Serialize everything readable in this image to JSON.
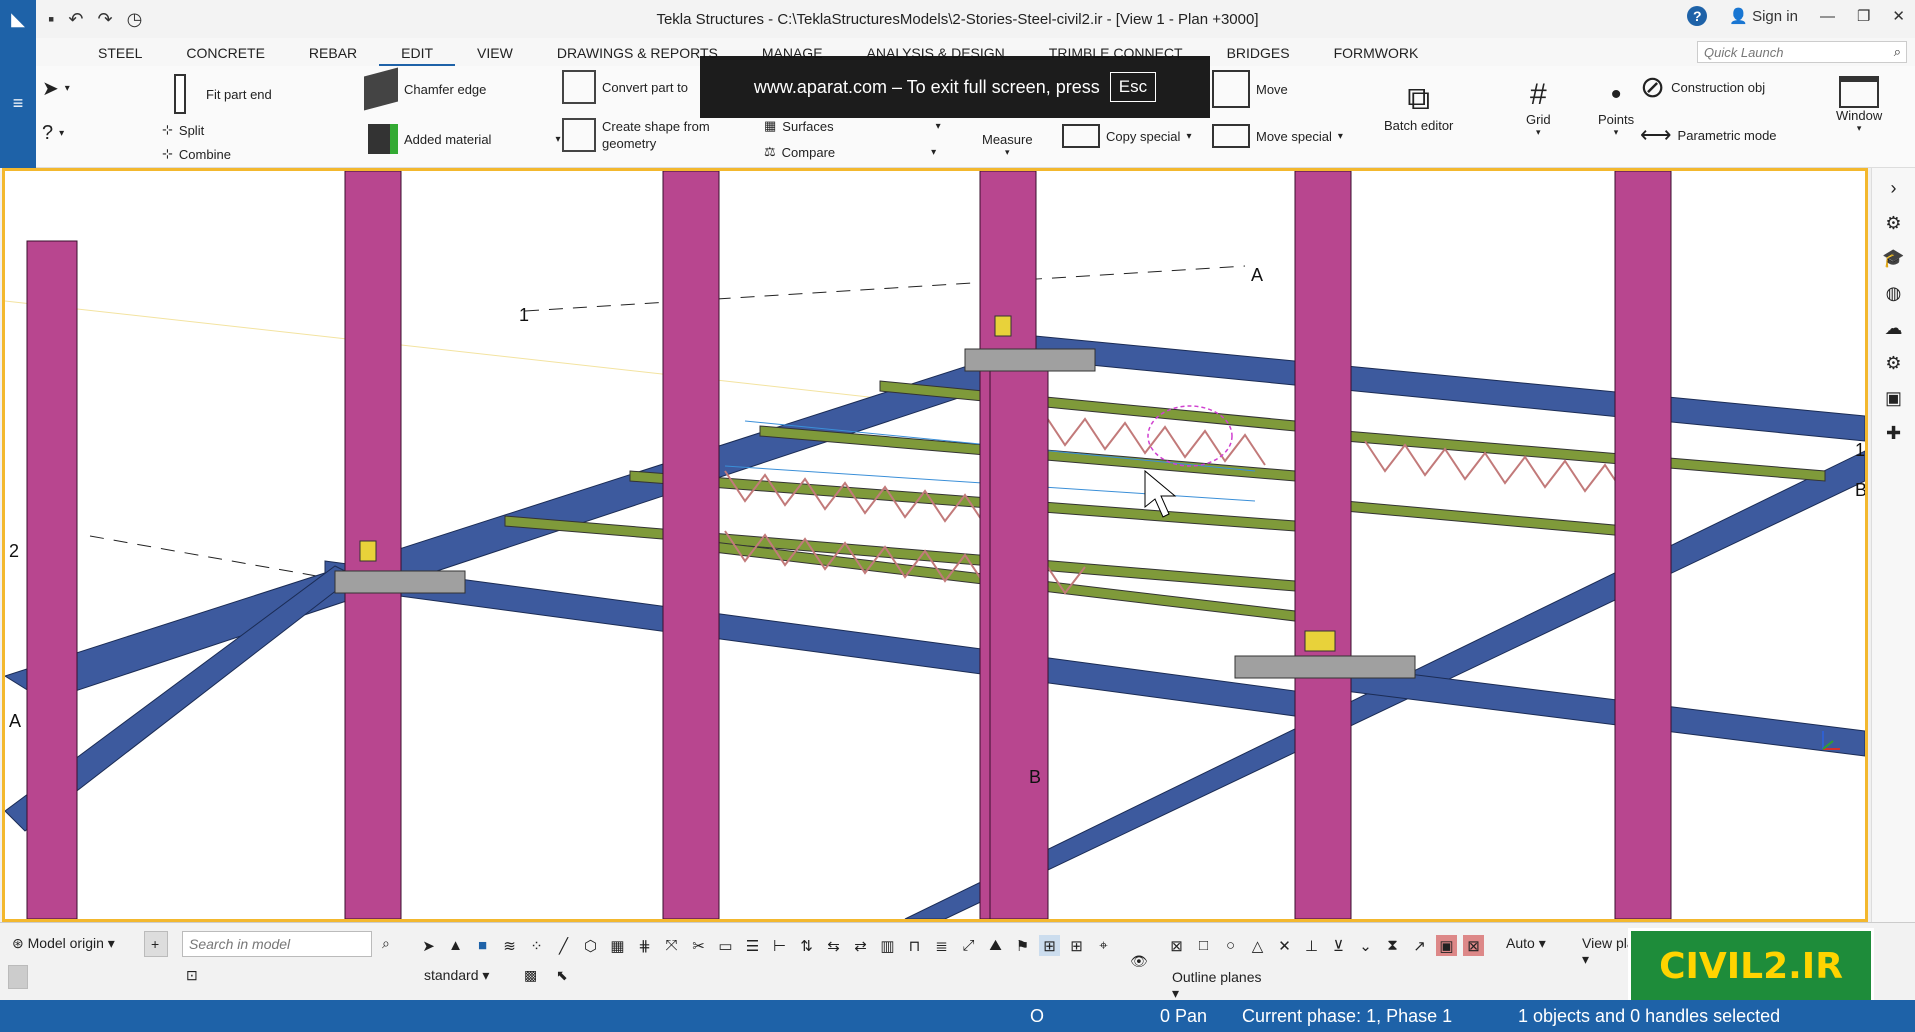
{
  "window": {
    "title": "Tekla Structures - C:\\TeklaStructuresModels\\2-Stories-Steel-civil2.ir  - [View 1 - Plan +3000]",
    "sign_in": "Sign in"
  },
  "tabs": [
    "STEEL",
    "CONCRETE",
    "REBAR",
    "EDIT",
    "VIEW",
    "DRAWINGS & REPORTS",
    "MANAGE",
    "ANALYSIS & DESIGN",
    "TRIMBLE CONNECT",
    "BRIDGES",
    "FORMWORK"
  ],
  "active_tab": "EDIT",
  "quick_launch": {
    "placeholder": "Quick Launch"
  },
  "ribbon": {
    "fit_part_end": "Fit part end",
    "split": "Split",
    "combine": "Combine",
    "chamfer_edge": "Chamfer edge",
    "added_material": "Added material",
    "convert_part": "Convert part to",
    "create_shape": "Create shape from",
    "create_shape_2": "geometry",
    "surfaces": "Surfaces",
    "compare": "Compare",
    "measure": "Measure",
    "copy_special": "Copy special",
    "move": "Move",
    "move_special": "Move special",
    "batch_editor": "Batch editor",
    "grid": "Grid",
    "points": "Points",
    "construction_obj": "Construction obj",
    "parametric_mode": "Parametric mode",
    "window": "Window"
  },
  "fullscreen_notice": {
    "text": "www.aparat.com – To exit full screen, press",
    "key": "Esc"
  },
  "viewport": {
    "grid_labels": {
      "label_a_top": "A",
      "label_1": "1",
      "label_2": "2",
      "label_a_left": "A",
      "label_b_bottom": "B",
      "label_b_right": "B",
      "label_1_right": "1"
    },
    "colors": {
      "column": "#b8468f",
      "beam": "#3d5a9e",
      "joist_chord": "#7f9a3a",
      "joist_web": "#c27a7a",
      "plate": "#e8d23a",
      "frame": "#f3b82e"
    }
  },
  "bottom": {
    "model_origin": "Model origin",
    "search_placeholder": "Search in model",
    "filter": "standard",
    "snap_mode": "Auto",
    "view_plane": "View plane",
    "outline_planes": "Outline planes"
  },
  "badge": "CIVIL2.IR",
  "status": {
    "o": "O",
    "pan": "0  Pan",
    "phase": "Current phase: 1, Phase 1",
    "selection": "1 objects and 0 handles selected"
  }
}
